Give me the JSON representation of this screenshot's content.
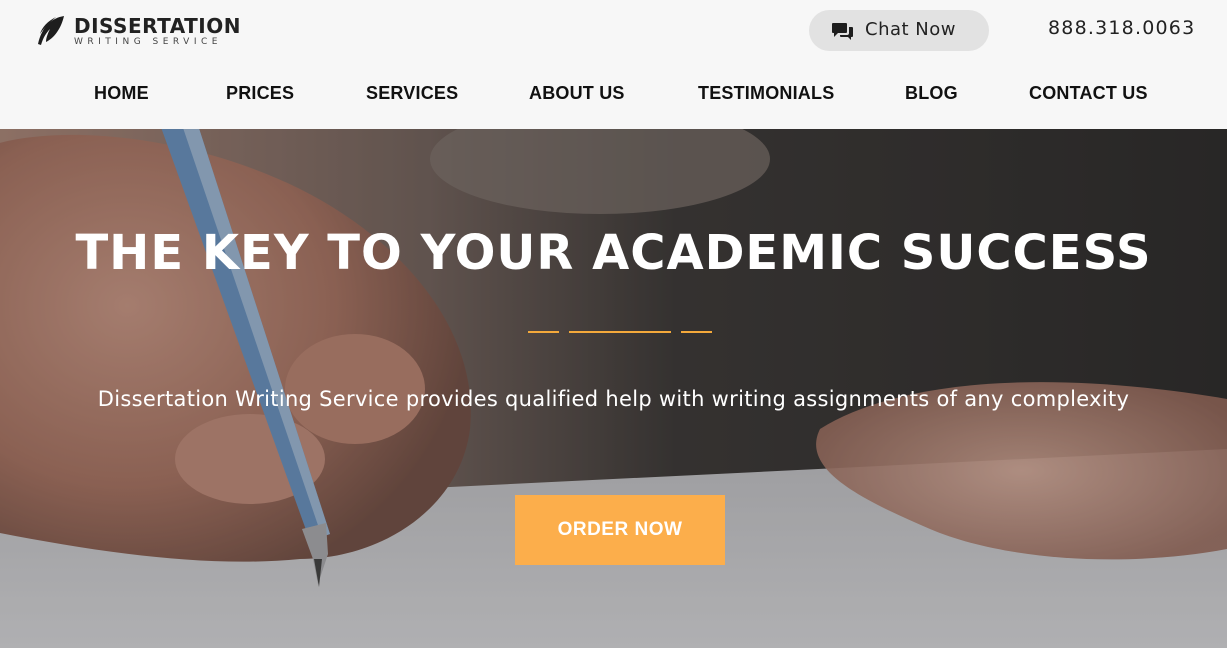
{
  "header": {
    "logo": {
      "title": "DISSERTATION",
      "subtitle": "WRITING SERVICE",
      "icon": "feather-icon"
    },
    "chat": {
      "label": "Chat Now",
      "icon": "chat-bubbles-icon"
    },
    "phone": "888.318.0063"
  },
  "nav": {
    "items": [
      {
        "label": "HOME"
      },
      {
        "label": "PRICES"
      },
      {
        "label": "SERVICES"
      },
      {
        "label": "ABOUT US"
      },
      {
        "label": "TESTIMONIALS"
      },
      {
        "label": "BLOG"
      },
      {
        "label": "CONTACT US"
      }
    ]
  },
  "hero": {
    "title": "THE KEY TO YOUR ACADEMIC SUCCESS",
    "subtitle": "Dissertation Writing Service provides qualified help with writing assignments of any complexity",
    "cta_label": "ORDER NOW",
    "background": "photo-hand-writing-with-blue-pen"
  },
  "colors": {
    "accent": "#fcae4b",
    "divider": "#f4a93b",
    "header_bg": "#f7f7f7",
    "chat_bg": "#e2e2e2",
    "text_dark": "#111111"
  }
}
